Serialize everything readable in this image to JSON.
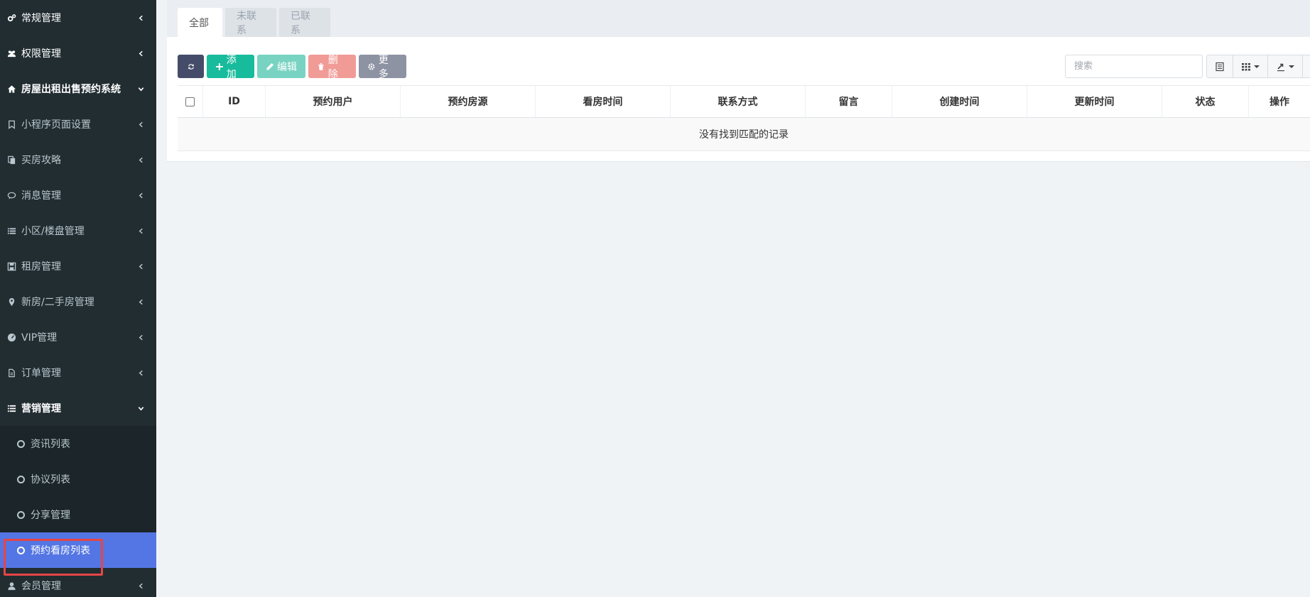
{
  "sidebar": {
    "items": [
      {
        "label": "常规管理",
        "icon": "cogs-icon",
        "kind": "top",
        "chevron": "left"
      },
      {
        "label": "权限管理",
        "icon": "group-icon",
        "kind": "top",
        "chevron": "left"
      },
      {
        "label": "房屋出租出售预约系统",
        "icon": "home-icon",
        "kind": "open",
        "chevron": "down"
      },
      {
        "label": "小程序页面设置",
        "icon": "bookmark-icon",
        "kind": "normal",
        "chevron": "left"
      },
      {
        "label": "买房攻略",
        "icon": "files-icon",
        "kind": "normal",
        "chevron": "left"
      },
      {
        "label": "消息管理",
        "icon": "comment-icon",
        "kind": "normal",
        "chevron": "left"
      },
      {
        "label": "小区/楼盘管理",
        "icon": "list-icon",
        "kind": "normal",
        "chevron": "left"
      },
      {
        "label": "租房管理",
        "icon": "floppy-icon",
        "kind": "normal",
        "chevron": "left"
      },
      {
        "label": "新房/二手房管理",
        "icon": "map-marker-icon",
        "kind": "normal",
        "chevron": "left"
      },
      {
        "label": "VIP管理",
        "icon": "dashboard-icon",
        "kind": "normal",
        "chevron": "left"
      },
      {
        "label": "订单管理",
        "icon": "file-text-icon",
        "kind": "normal",
        "chevron": "left"
      },
      {
        "label": "营销管理",
        "icon": "list-alt-icon",
        "kind": "open",
        "chevron": "down"
      }
    ],
    "subitems": [
      {
        "label": "资讯列表",
        "active": false
      },
      {
        "label": "协议列表",
        "active": false
      },
      {
        "label": "分享管理",
        "active": false
      },
      {
        "label": "预约看房列表",
        "active": true
      }
    ],
    "footer_item": {
      "label": "会员管理",
      "icon": "user-icon"
    }
  },
  "tabs": [
    {
      "label": "全部",
      "active": true
    },
    {
      "label": "未联系",
      "active": false
    },
    {
      "label": "已联系",
      "active": false
    }
  ],
  "toolbar": {
    "add": "添加",
    "edit": "编辑",
    "delete": "删除",
    "more": "更多"
  },
  "search": {
    "placeholder": "搜索"
  },
  "table": {
    "columns": [
      "ID",
      "预约用户",
      "预约房源",
      "看房时间",
      "联系方式",
      "留言",
      "创建时间",
      "更新时间",
      "状态",
      "操作"
    ],
    "empty_text": "没有找到匹配的记录"
  },
  "colors": {
    "sidebar_bg": "#222d32",
    "active_item": "#5476e4",
    "add": "#18bc9c",
    "edit": "#79d3c2",
    "delete": "#f19b97",
    "more": "#8d93a3",
    "refresh": "#444c69",
    "highlight": "#e64545"
  }
}
